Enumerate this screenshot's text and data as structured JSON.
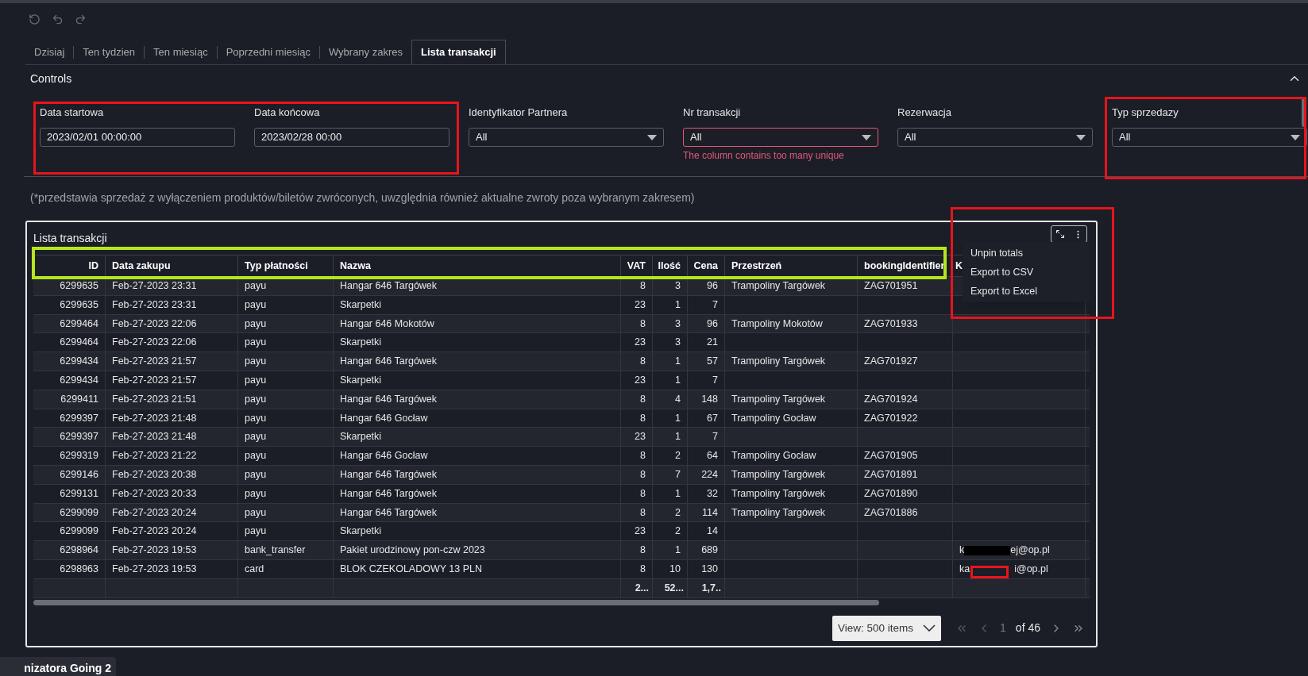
{
  "toolbar": {
    "buttons": [
      {
        "kind": "refresh"
      },
      {
        "kind": "undo"
      },
      {
        "kind": "redo"
      }
    ]
  },
  "tabs": [
    {
      "label": "Dzisiaj",
      "selected": false
    },
    {
      "label": "Ten tydzien",
      "selected": false
    },
    {
      "label": "Ten miesiąc",
      "selected": false
    },
    {
      "label": "Poprzedni miesiąc",
      "selected": false
    },
    {
      "label": "Wybrany zakres",
      "selected": false
    },
    {
      "label": "Lista transakcji",
      "selected": true
    }
  ],
  "controls": {
    "title": "Controls",
    "expanded": true,
    "filters": [
      {
        "kind": "text",
        "label": "Data startowa",
        "value": "2023/02/01 00:00:00"
      },
      {
        "kind": "text",
        "label": "Data końcowa",
        "value": "2023/02/28 00:00"
      },
      {
        "kind": "select",
        "label": "Identyfikator Partnera",
        "value": "All"
      },
      {
        "kind": "select",
        "label": "Nr transakcji",
        "value": "All",
        "error": "The column contains too many unique"
      },
      {
        "kind": "select",
        "label": "Rezerwacja",
        "value": "All"
      },
      {
        "kind": "select",
        "label": "Typ sprzedazy",
        "value": "All"
      }
    ]
  },
  "note": "(*przedstawia sprzedaż z wyłączeniem produktów/biletów zwróconych, uwzględnia również aktualne zwroty poza wybranym zakresem)",
  "card": {
    "title": "Lista transakcji",
    "menu": [
      "Unpin totals",
      "Export to CSV",
      "Export to Excel"
    ],
    "table": {
      "columns": [
        "ID",
        "Data zakupu",
        "Typ płatności",
        "Nazwa",
        "VAT",
        "Ilość",
        "Cena",
        "Przestrzeń",
        "bookingIdentifier",
        "K"
      ],
      "rows": [
        {
          "cells": [
            "6299635",
            "Feb-27-2023 23:31",
            "payu",
            "Hangar 646 Targówek",
            "8",
            "3",
            "96",
            "Trampoliny Targówek",
            "ZAG701951"
          ]
        },
        {
          "cells": [
            "6299635",
            "Feb-27-2023 23:31",
            "payu",
            "Skarpetki",
            "23",
            "1",
            "7"
          ]
        },
        {
          "cells": [
            "6299464",
            "Feb-27-2023 22:06",
            "payu",
            "Hangar 646 Mokotów",
            "8",
            "3",
            "96",
            "Trampoliny Mokotów",
            "ZAG701933"
          ]
        },
        {
          "cells": [
            "6299464",
            "Feb-27-2023 22:06",
            "payu",
            "Skarpetki",
            "23",
            "3",
            "21"
          ]
        },
        {
          "cells": [
            "6299434",
            "Feb-27-2023 21:57",
            "payu",
            "Hangar 646 Targówek",
            "8",
            "1",
            "57",
            "Trampoliny Targówek",
            "ZAG701927"
          ]
        },
        {
          "cells": [
            "6299434",
            "Feb-27-2023 21:57",
            "payu",
            "Skarpetki",
            "23",
            "1",
            "7"
          ]
        },
        {
          "cells": [
            "6299411",
            "Feb-27-2023 21:51",
            "payu",
            "Hangar 646 Targówek",
            "8",
            "4",
            "148",
            "Trampoliny Targówek",
            "ZAG701924"
          ]
        },
        {
          "cells": [
            "6299397",
            "Feb-27-2023 21:48",
            "payu",
            "Hangar 646 Gocław",
            "8",
            "1",
            "67",
            "Trampoliny Gocław",
            "ZAG701922"
          ]
        },
        {
          "cells": [
            "6299397",
            "Feb-27-2023 21:48",
            "payu",
            "Skarpetki",
            "23",
            "1",
            "7"
          ]
        },
        {
          "cells": [
            "6299319",
            "Feb-27-2023 21:22",
            "payu",
            "Hangar 646 Gocław",
            "8",
            "2",
            "64",
            "Trampoliny Gocław",
            "ZAG701905"
          ]
        },
        {
          "cells": [
            "6299146",
            "Feb-27-2023 20:38",
            "payu",
            "Hangar 646 Targówek",
            "8",
            "7",
            "224",
            "Trampoliny Targówek",
            "ZAG701891"
          ]
        },
        {
          "cells": [
            "6299131",
            "Feb-27-2023 20:33",
            "payu",
            "Hangar 646 Targówek",
            "8",
            "1",
            "32",
            "Trampoliny Targówek",
            "ZAG701890"
          ]
        },
        {
          "cells": [
            "6299099",
            "Feb-27-2023 20:24",
            "payu",
            "Hangar 646 Targówek",
            "8",
            "2",
            "114",
            "Trampoliny Targówek",
            "ZAG701886"
          ]
        },
        {
          "cells": [
            "6299099",
            "Feb-27-2023 20:24",
            "payu",
            "Skarpetki",
            "23",
            "2",
            "14"
          ]
        },
        {
          "cells": [
            "6298964",
            "Feb-27-2023 19:53",
            "bank_transfer",
            "Pakiet urodzinowy pon-czw 2023",
            "8",
            "1",
            "689"
          ],
          "contact": {
            "start": "k",
            "end": "ej@op.pl",
            "redacted": true
          }
        },
        {
          "cells": [
            "6298963",
            "Feb-27-2023 19:53",
            "card",
            "BLOK CZEKOLADOWY 13 PLN",
            "8",
            "10",
            "130"
          ],
          "contact": {
            "start": "ka",
            "end": "i@op.pl",
            "redacted": false
          }
        }
      ],
      "totals": {
        "vat": "2...",
        "qty": "52...",
        "price": "1,7.."
      }
    },
    "pagination": {
      "page_size": "View: 500 items",
      "page": "1",
      "of": "of 46"
    }
  },
  "bottom_tab": "nizatora Going 2",
  "annotations": [
    {
      "color": "#e8141c"
    },
    {
      "color": "#e8141c"
    },
    {
      "color": "#e8141c"
    },
    {
      "color": "#b5e61d"
    },
    {
      "color": "#e8141c"
    }
  ]
}
